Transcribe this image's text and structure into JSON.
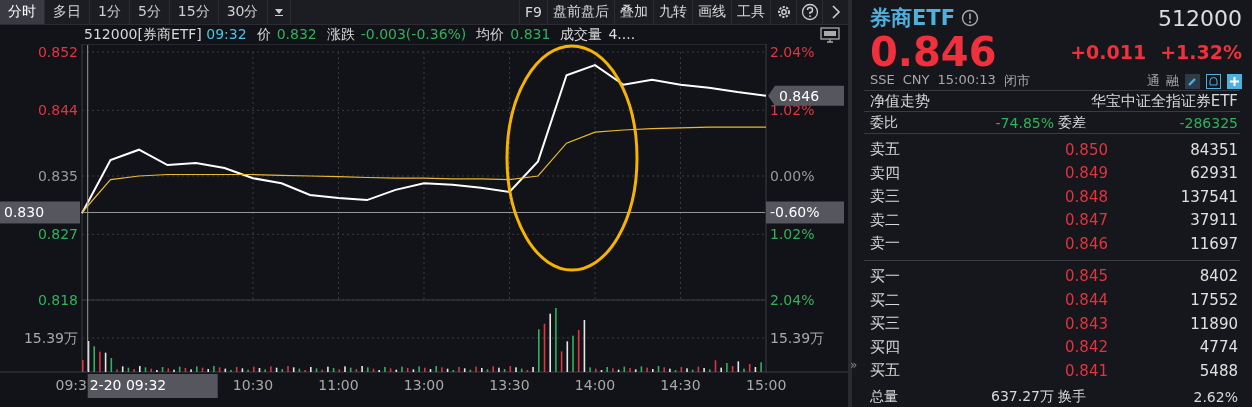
{
  "toolbar": {
    "tabs": [
      {
        "label": "分时",
        "selected": true
      },
      {
        "label": "多日",
        "selected": false
      },
      {
        "label": "1分",
        "selected": false
      },
      {
        "label": "5分",
        "selected": false
      },
      {
        "label": "15分",
        "selected": false
      },
      {
        "label": "30分",
        "selected": false
      }
    ],
    "tools": [
      "F9",
      "盘前盘后",
      "叠加",
      "九转",
      "画线",
      "工具"
    ]
  },
  "chart_header": {
    "title": "512000[券商ETF]",
    "time": "09:32",
    "fields": [
      {
        "label": "价",
        "value": "0.832",
        "color": "#2eb35a"
      },
      {
        "label": "涨跌",
        "value": "-0.003(-0.36%)",
        "color": "#2eb35a"
      },
      {
        "label": "均价",
        "value": "0.831",
        "color": "#2eb35a"
      },
      {
        "label": "成交量",
        "value": "4....",
        "color": "#dddddd"
      }
    ]
  },
  "chart_data": {
    "type": "line",
    "categories": [
      "09:3",
      null,
      null,
      null,
      null,
      null,
      "10:30",
      null,
      null,
      "11:00",
      null,
      null,
      "13:00",
      null,
      null,
      "13:30",
      null,
      null,
      "14:00",
      null,
      null,
      "14:30",
      null,
      null,
      "15:00"
    ],
    "grid": true,
    "series": [
      {
        "color": "#ffffff",
        "values": [
          0.8299,
          0.8372,
          0.8386,
          0.8365,
          0.8368,
          0.8361,
          0.8347,
          0.834,
          0.8324,
          0.832,
          0.8317,
          0.8331,
          0.834,
          0.8338,
          0.8334,
          0.8328,
          0.837,
          0.8488,
          0.8502,
          0.8475,
          0.8482,
          0.8475,
          0.8471,
          0.8465,
          0.846
        ]
      },
      {
        "color": "#e8b830",
        "values": [
          0.83,
          0.8345,
          0.835,
          0.8352,
          0.8352,
          0.8352,
          0.8352,
          0.8351,
          0.835,
          0.8349,
          0.8348,
          0.8347,
          0.8347,
          0.8346,
          0.8346,
          0.8345,
          0.835,
          0.8395,
          0.841,
          0.8413,
          0.8415,
          0.8416,
          0.8417,
          0.8417,
          0.8417
        ]
      }
    ],
    "ylim": [
      0.818,
      0.852
    ],
    "yticks": [
      {
        "value": 0.852,
        "label": "0.852"
      },
      {
        "value": 0.844,
        "label": "0.844"
      },
      {
        "value": 0.835,
        "label": "0.835"
      },
      {
        "value": 0.827,
        "label": "0.827"
      },
      {
        "value": 0.818,
        "label": "0.818"
      }
    ]
  },
  "left_axis_labels": [
    {
      "color": "#e0343f"
    },
    {
      "color": "#e0343f"
    },
    {
      "color": "#9a9a9a"
    },
    {
      "color": "#2eb35a"
    },
    {
      "color": "#2eb35a"
    }
  ],
  "right_axis_labels": [
    {
      "text": "2.04%",
      "color": "#e0343f"
    },
    {
      "text": "1.02%",
      "color": "#e0343f"
    },
    {
      "text": "0.00%",
      "color": "#9a9a9a"
    },
    {
      "text": "1.02%",
      "color": "#2eb35a"
    },
    {
      "text": "2.04%",
      "color": "#2eb35a"
    }
  ],
  "last_price_tag": "0.846",
  "cursor": {
    "time": "2-20 09:32",
    "price": "0.830",
    "percent": "-0.60%"
  },
  "volume_axis": {
    "left": "15.39万",
    "right": "15.39万"
  },
  "quote": {
    "name": "券商ETF",
    "code": "512000",
    "price": "0.846",
    "change": "+0.011",
    "change_pct": "+1.32%",
    "exchange": "SSE",
    "currency": "CNY",
    "time": "15:00:13",
    "status": "闭市",
    "flags": [
      "通",
      "融"
    ]
  },
  "nav_row": {
    "label": "净值走势",
    "fund_name": "华宝中证全指证券ETF"
  },
  "ratio_row": {
    "label": "委比",
    "value": "-74.85%",
    "diff_label": "委差",
    "diff_value": "-286325"
  },
  "asks": [
    {
      "label": "卖五",
      "price": "0.850",
      "volume": "84351"
    },
    {
      "label": "卖四",
      "price": "0.849",
      "volume": "62931"
    },
    {
      "label": "卖三",
      "price": "0.848",
      "volume": "137541"
    },
    {
      "label": "卖二",
      "price": "0.847",
      "volume": "37911"
    },
    {
      "label": "卖一",
      "price": "0.846",
      "volume": "11697"
    }
  ],
  "bids": [
    {
      "label": "买一",
      "price": "0.845",
      "volume": "8402"
    },
    {
      "label": "买二",
      "price": "0.844",
      "volume": "17552"
    },
    {
      "label": "买三",
      "price": "0.843",
      "volume": "11890"
    },
    {
      "label": "买四",
      "price": "0.842",
      "volume": "4774"
    },
    {
      "label": "买五",
      "price": "0.841",
      "volume": "5488"
    }
  ],
  "totals": {
    "label": "总量",
    "value": "637.27万",
    "turnover_label": "换手",
    "turnover": "2.62%"
  },
  "side_toggle": "»"
}
